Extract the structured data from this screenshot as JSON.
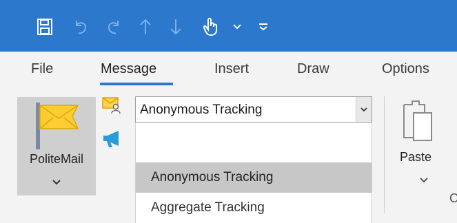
{
  "quick_access": {
    "icons": [
      "save-icon",
      "undo-icon",
      "redo-icon",
      "move-up-icon",
      "move-down-icon",
      "touch-mode-icon",
      "chevron-down-icon",
      "customize-icon"
    ]
  },
  "tabs": [
    {
      "label": "File",
      "active": false
    },
    {
      "label": "Message",
      "active": true
    },
    {
      "label": "Insert",
      "active": false
    },
    {
      "label": "Draw",
      "active": false
    },
    {
      "label": "Options",
      "active": false
    }
  ],
  "politemail": {
    "label": "PoliteMail"
  },
  "tracking": {
    "selected": "Anonymous Tracking",
    "options": [
      {
        "label": "",
        "selected": false
      },
      {
        "label": "Anonymous Tracking",
        "selected": true
      },
      {
        "label": "Aggregate Tracking",
        "selected": false
      }
    ]
  },
  "clipboard": {
    "paste_label": "Paste",
    "group_label_partial": "C"
  },
  "colors": {
    "titlebar": "#2b78cc",
    "ribbon": "#f3f3f3",
    "selected_item": "#c7c7c7",
    "accent": "#2b78cc"
  }
}
